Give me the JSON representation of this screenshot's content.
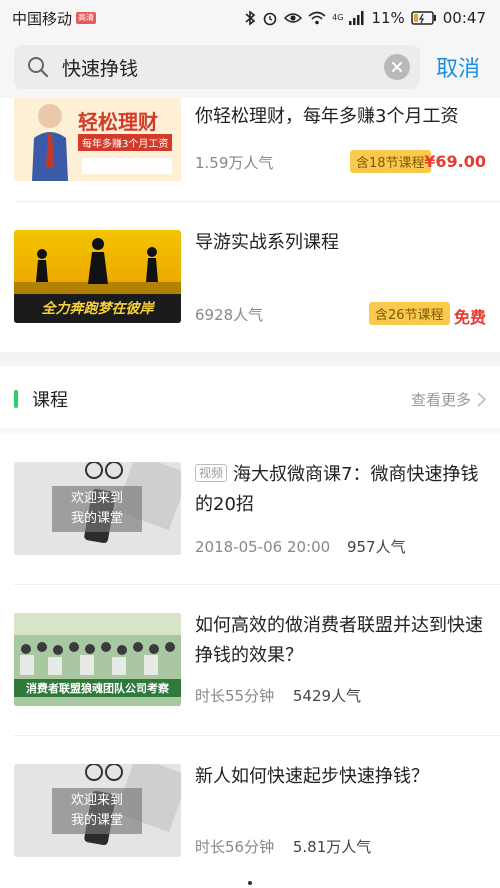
{
  "status": {
    "carrier": "中国移动",
    "hd": "高清",
    "network": "4G",
    "battery": "11%",
    "time": "00:47"
  },
  "search": {
    "query": "快速挣钱",
    "cancel": "取消"
  },
  "results": [
    {
      "title": "你轻松理财，每年多赚3个月工资",
      "popularity": "1.59万人气",
      "lessons": "含18节课程",
      "price": "¥69.00",
      "thumb_text": "轻松理财",
      "thumb_sub": "每年多赚3个月工资"
    },
    {
      "title": "导游实战系列课程",
      "popularity": "6928人气",
      "lessons": "含26节课程",
      "price": "免费",
      "thumb_text": "全力奔跑梦在彼岸"
    }
  ],
  "courses_section": {
    "title": "课程",
    "see_more": "查看更多"
  },
  "courses": [
    {
      "tag": "视频",
      "title": "海大叔微商课7：微商快速挣钱的20招",
      "date": "2018-05-06 20:00",
      "popularity": "957人气",
      "thumb_text_1": "欢迎来到",
      "thumb_text_2": "我的课堂"
    },
    {
      "title": "如何高效的做消费者联盟并达到快速挣钱的效果？",
      "duration": "时长55分钟",
      "popularity": "5429人气",
      "thumb_text": "消费者联盟狼魂团队公司考察"
    },
    {
      "title": "新人如何快速起步快速挣钱？",
      "duration": "时长56分钟",
      "popularity": "5.81万人气",
      "thumb_text_1": "欢迎来到",
      "thumb_text_2": "我的课堂"
    }
  ],
  "colors": {
    "accent": "#1a8fe0",
    "price": "#e63b2e",
    "tag": "#fbc94d",
    "section_bar": "#2ecc71"
  }
}
